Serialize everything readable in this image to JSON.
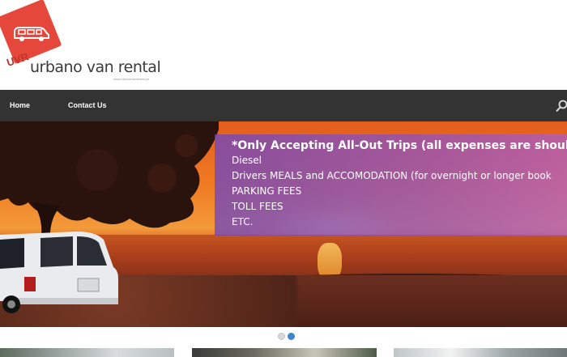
{
  "brand": {
    "abbr": "UVR",
    "name": "urbano van rental",
    "tagline": "www.urbanovanrental.ph"
  },
  "nav": {
    "items": [
      {
        "label": "Home"
      },
      {
        "label": "Contact Us"
      }
    ],
    "search_icon": "search-icon"
  },
  "slider": {
    "title": "*Only Accepting All-Out Trips (all expenses are shoulde",
    "lines": [
      "Diesel",
      "Drivers MEALS and ACCOMODATION (for overnight or longer book",
      "PARKING FEES",
      "TOLL FEES",
      "ETC."
    ],
    "active_slide": 2,
    "total_slides": 2
  },
  "colors": {
    "navbar": "#333334",
    "logo_red": "#e5473a",
    "overlay_purple": "#8c50c8",
    "active_dot": "#3f86c8"
  }
}
